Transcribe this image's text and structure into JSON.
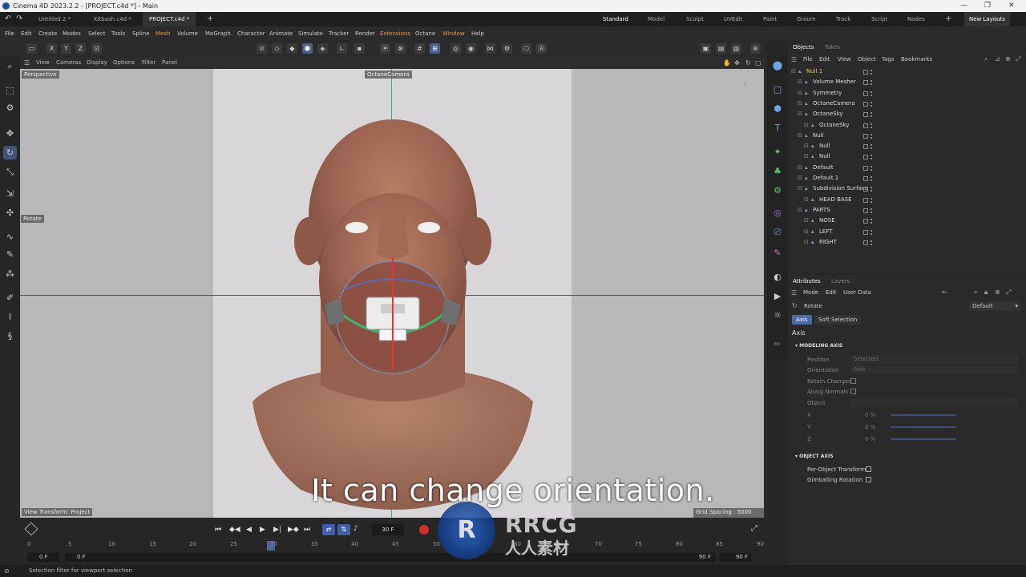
{
  "window": {
    "title": "Cinema 4D 2023.2.2 - [PROJECT.c4d *] - Main",
    "controls": [
      "—",
      "❐",
      "✕"
    ]
  },
  "doc_tabs": [
    "Untitled 2 *",
    "Kitbash.c4d *",
    "PROJECT.c4d *"
  ],
  "new_tab": "+",
  "layouts": [
    "Standard",
    "Model",
    "Sculpt",
    "UVEdit",
    "Paint",
    "Groom",
    "Track",
    "Script",
    "Nodes"
  ],
  "new_layouts": "New Layouts",
  "menus": [
    "File",
    "Edit",
    "Create",
    "Modes",
    "Select",
    "Tools",
    "Spline",
    "Mesh",
    "Volume",
    "MoGraph",
    "Character",
    "Animate",
    "Simulate",
    "Tracker",
    "Render",
    "Extensions",
    "Octane",
    "Window",
    "Help"
  ],
  "axis_toggles": [
    "X",
    "Y",
    "Z"
  ],
  "viewport_menu": [
    "View",
    "Cameras",
    "Display",
    "Options",
    "Filter",
    "Panel"
  ],
  "viewport": {
    "name": "Perspective",
    "camera": "OctaneCamera",
    "tool_label": "Rotate",
    "view_transform": "View Transform: Project",
    "grid_spacing": "Grid Spacing : 5000 cm"
  },
  "subtitle": "It can change orientation.",
  "watermark": {
    "brand": "RRCG",
    "cn": "人人素材"
  },
  "timeline": {
    "frame_field": "30 F",
    "ticks": [
      "0",
      "5",
      "10",
      "15",
      "20",
      "25",
      "30",
      "35",
      "40",
      "45",
      "50",
      "55",
      "60",
      "65",
      "70",
      "75",
      "80",
      "85",
      "90"
    ],
    "start": "0 F",
    "start2": "0 F",
    "end": "90 F",
    "end2": "90 F",
    "playhead": 30
  },
  "status": "Selection filter for viewport selection",
  "objects_panel": {
    "tabs": [
      "Objects",
      "Takes"
    ],
    "menu": [
      "File",
      "Edit",
      "View",
      "Object",
      "Tags",
      "Bookmarks"
    ],
    "items": [
      {
        "name": "Null.1",
        "indent": 0,
        "color": "#e3c56a"
      },
      {
        "name": "Volume Mesher",
        "indent": 1,
        "color": "#ddd"
      },
      {
        "name": "Symmetry",
        "indent": 1,
        "color": "#ddd"
      },
      {
        "name": "OctaneCamera",
        "indent": 1,
        "color": "#ddd"
      },
      {
        "name": "OctaneSky",
        "indent": 1,
        "color": "#ddd"
      },
      {
        "name": "OctaneSky",
        "indent": 2,
        "color": "#ddd"
      },
      {
        "name": "Null",
        "indent": 1,
        "color": "#ddd"
      },
      {
        "name": "Null",
        "indent": 2,
        "color": "#ddd"
      },
      {
        "name": "Null",
        "indent": 2,
        "color": "#ddd"
      },
      {
        "name": "Default",
        "indent": 1,
        "color": "#ddd"
      },
      {
        "name": "Default.1",
        "indent": 1,
        "color": "#ddd"
      },
      {
        "name": "Subdivision Surface",
        "indent": 1,
        "color": "#ddd"
      },
      {
        "name": "HEAD BASE",
        "indent": 2,
        "color": "#ddd"
      },
      {
        "name": "PARTS",
        "indent": 1,
        "color": "#ddd"
      },
      {
        "name": "NOSE",
        "indent": 2,
        "color": "#ddd"
      },
      {
        "name": "LEFT",
        "indent": 2,
        "color": "#ddd"
      },
      {
        "name": "RIGHT",
        "indent": 2,
        "color": "#ddd"
      }
    ]
  },
  "attributes_panel": {
    "tabs": [
      "Attributes",
      "Layers"
    ],
    "menu": [
      "Mode",
      "Edit",
      "User Data"
    ],
    "tool": "Rotate",
    "preset": "Default",
    "subtabs": [
      "Axis",
      "Soft Selection"
    ],
    "section": "Axis",
    "modeling_axis": "MODELING AXIS",
    "fields": [
      {
        "label": "Position",
        "value": "Selected"
      },
      {
        "label": "Orientation",
        "value": "Axis"
      },
      {
        "label": "Retain Changes",
        "value": ""
      },
      {
        "label": "Along Normals",
        "value": ""
      },
      {
        "label": "Object",
        "value": ""
      },
      {
        "label": "X",
        "value": "0 %"
      },
      {
        "label": "Y",
        "value": "0 %"
      },
      {
        "label": "Z",
        "value": "0 %"
      }
    ],
    "object_axis": "OBJECT AXIS",
    "object_fields": [
      "Per-Object Transform",
      "Gimballing Rotation"
    ]
  },
  "colors": {
    "accent": "#4a6aa8",
    "highlight_menu": "#e39a3a",
    "null_label": "#e3c56a"
  }
}
